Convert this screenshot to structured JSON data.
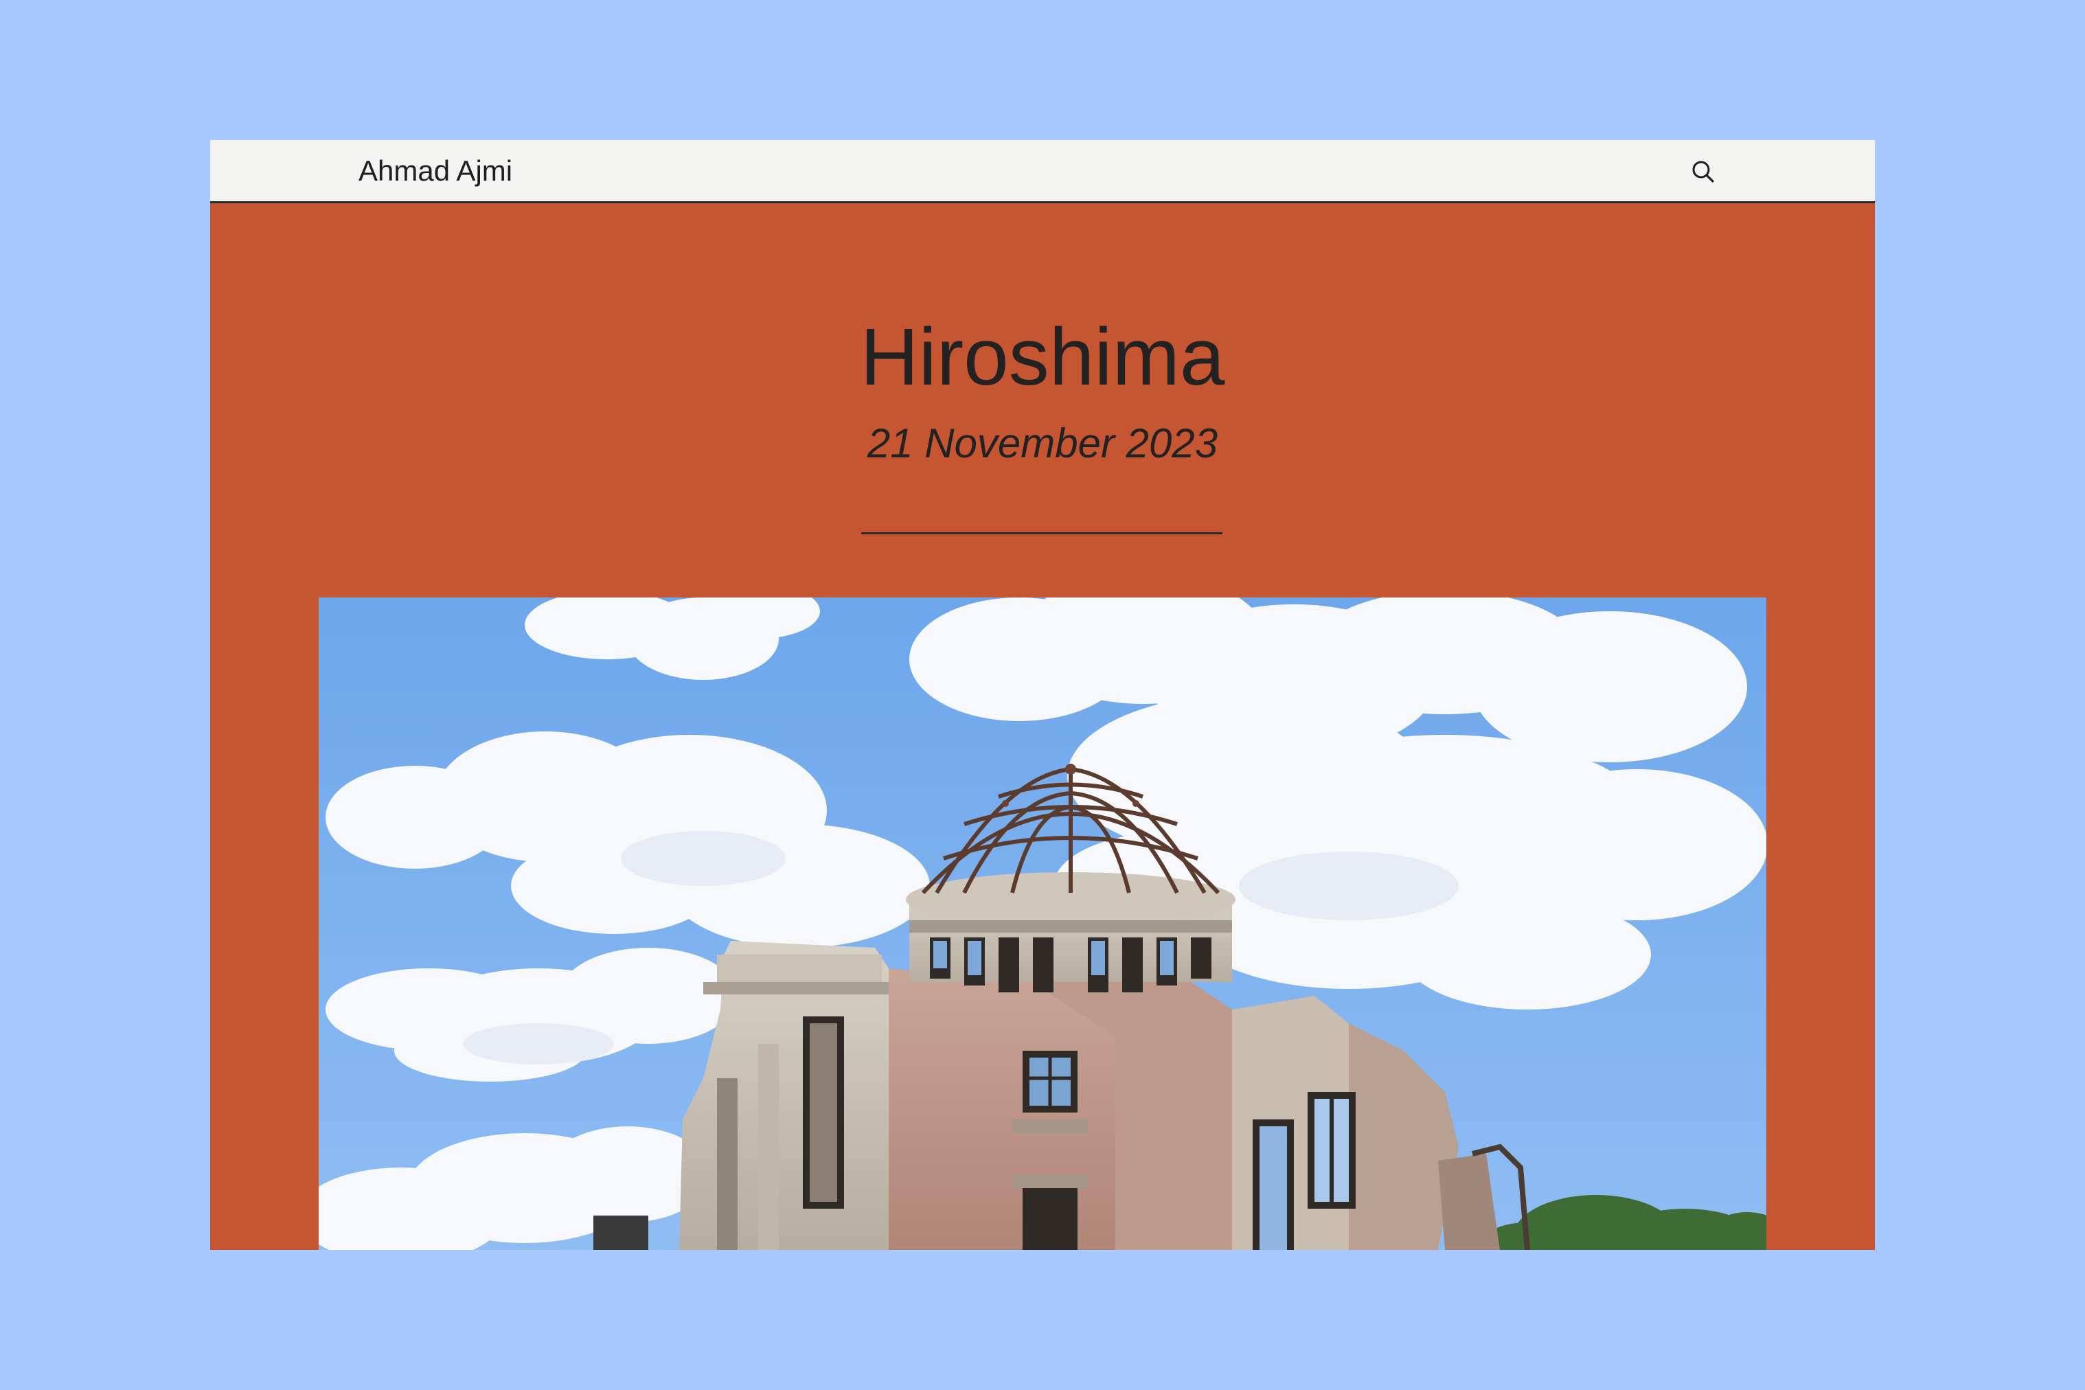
{
  "site": {
    "name": "Ahmad Ajmi"
  },
  "post": {
    "title": "Hiroshima",
    "date": "21 November 2023"
  },
  "icons": {
    "search": "search-icon"
  },
  "colors": {
    "page_background": "#a8c8fe",
    "topbar_background": "#f3f3f2",
    "content_background": "#c65531",
    "text": "#222222"
  }
}
